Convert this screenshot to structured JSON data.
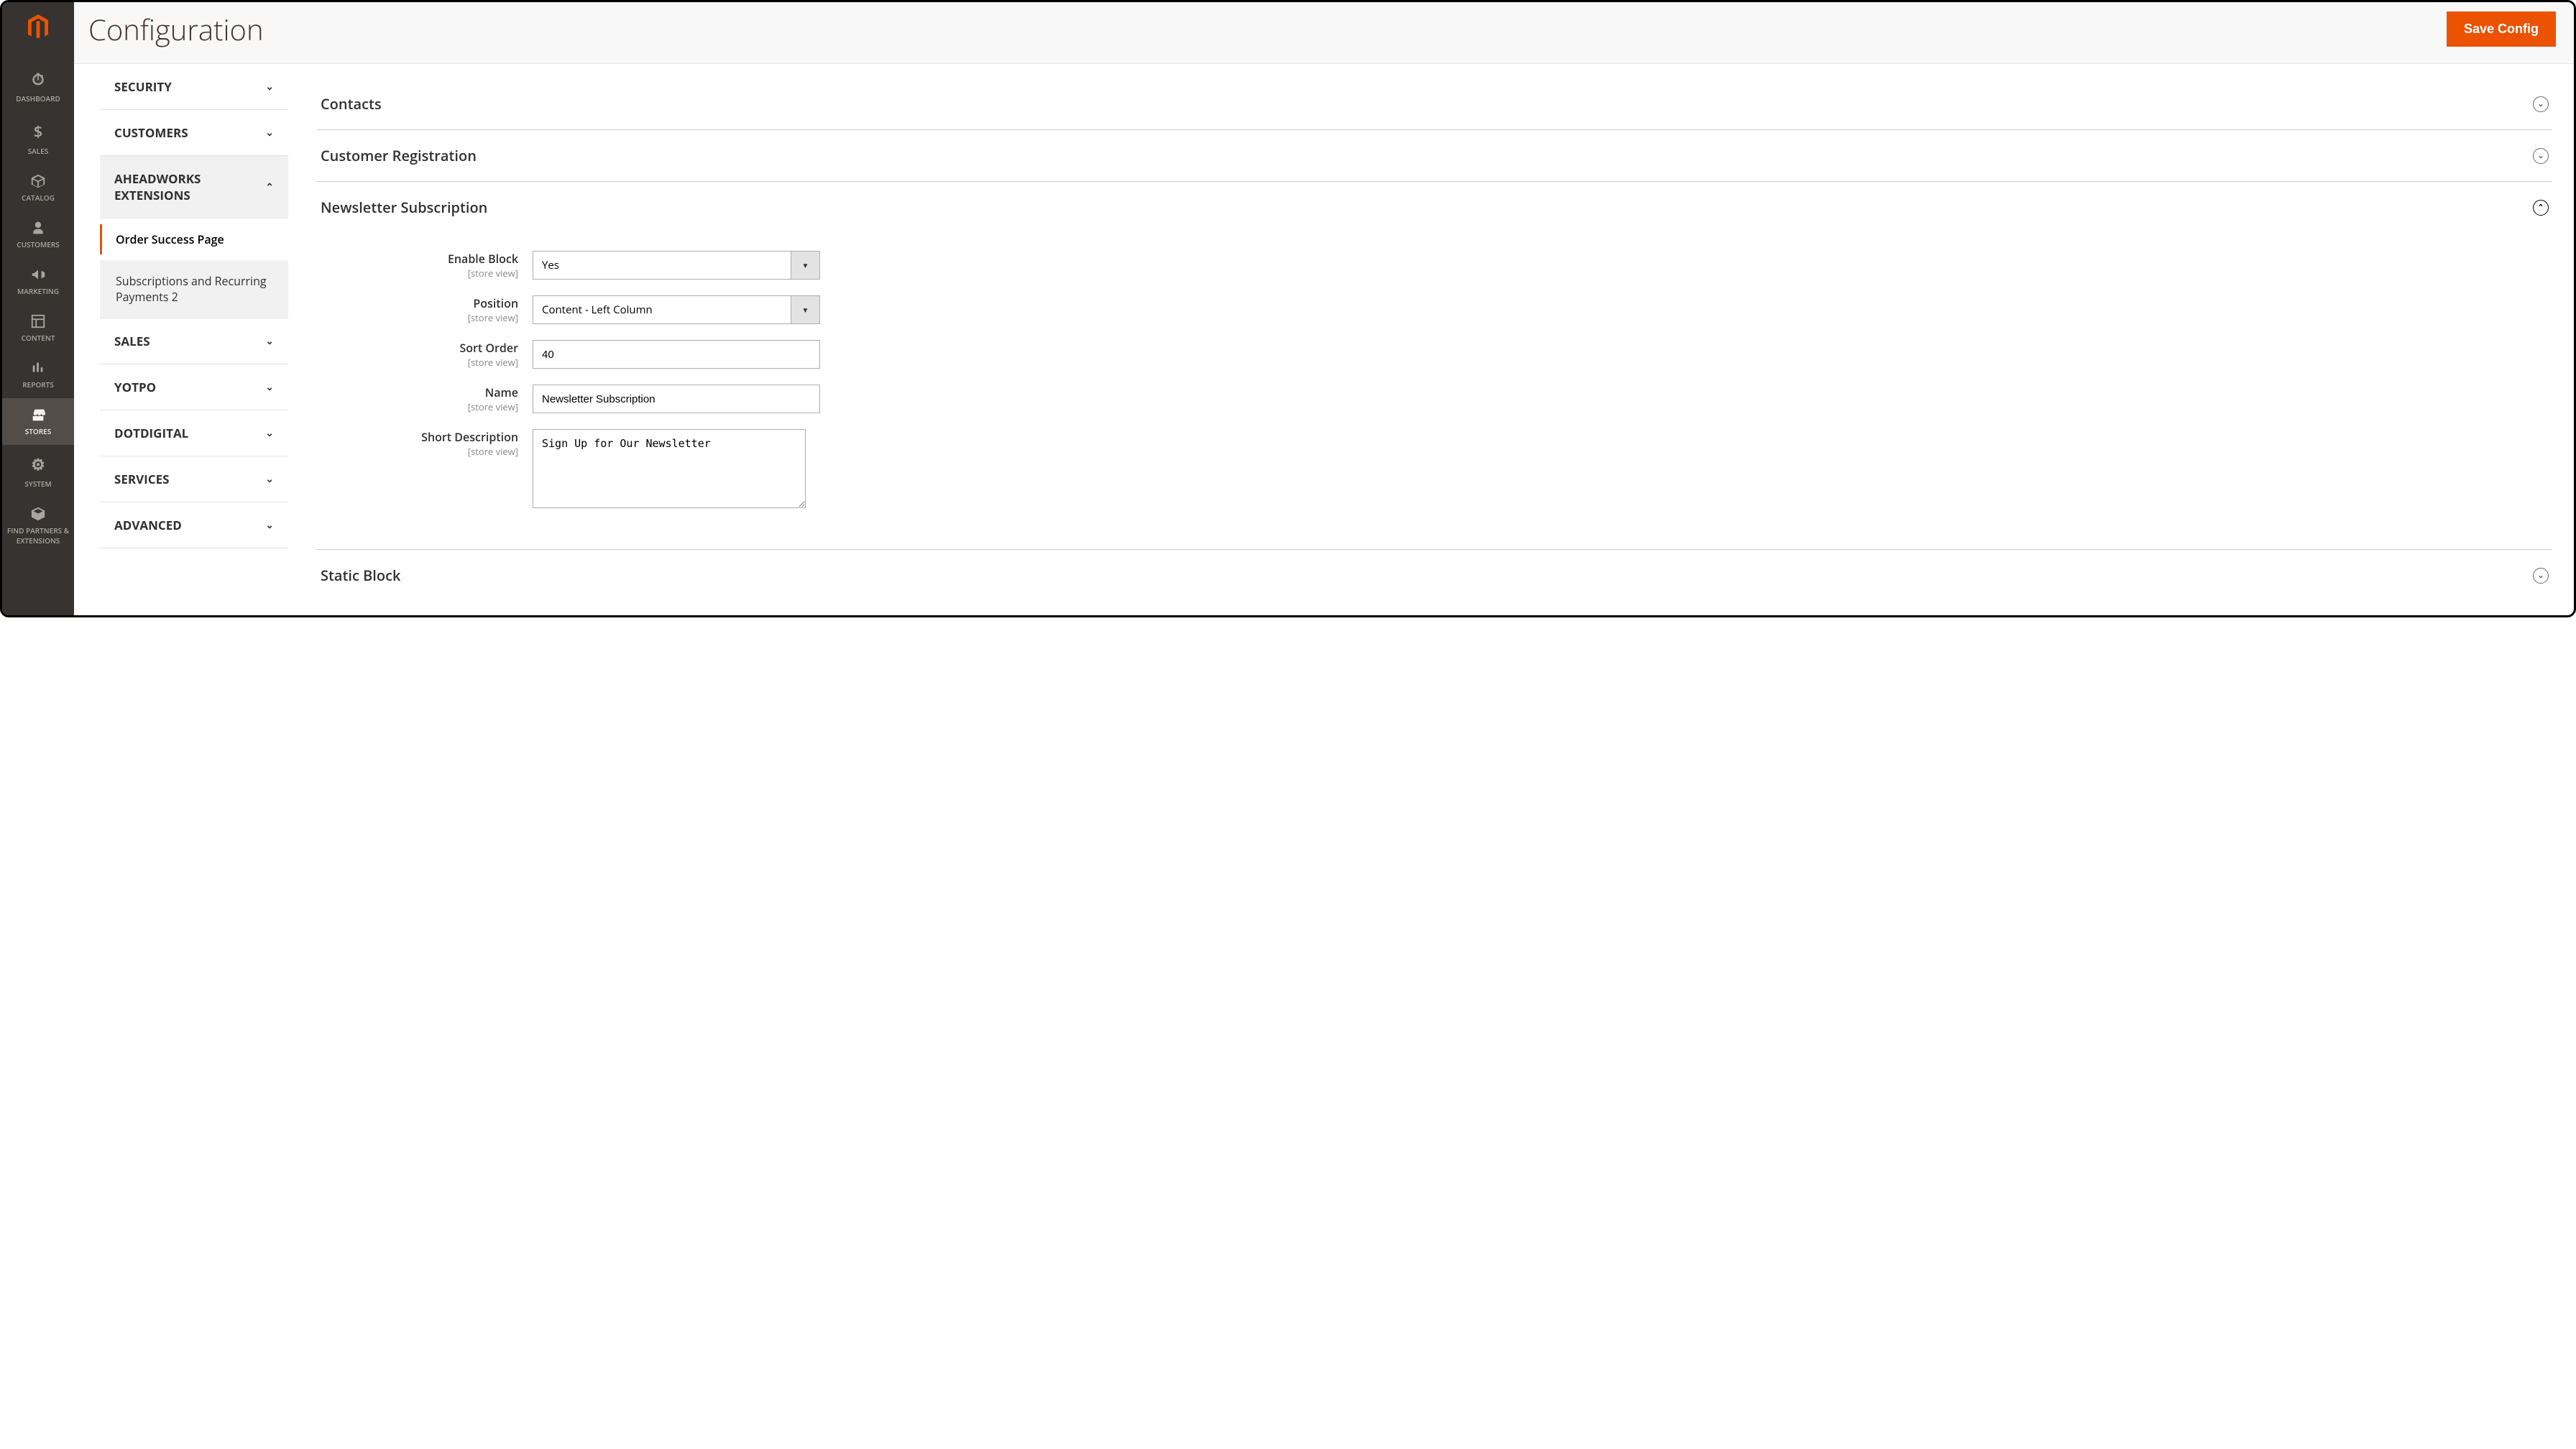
{
  "page": {
    "title": "Configuration",
    "save_button": "Save Config"
  },
  "nav": {
    "dashboard": "DASHBOARD",
    "sales": "SALES",
    "catalog": "CATALOG",
    "customers": "CUSTOMERS",
    "marketing": "MARKETING",
    "content": "CONTENT",
    "reports": "REPORTS",
    "stores": "STORES",
    "system": "SYSTEM",
    "partners": "FIND PARTNERS & EXTENSIONS"
  },
  "sidebar": [
    {
      "label": "SECURITY",
      "expanded": false
    },
    {
      "label": "CUSTOMERS",
      "expanded": false
    },
    {
      "label": "AHEADWORKS EXTENSIONS",
      "expanded": true,
      "items": [
        {
          "label": "Order Success Page",
          "active": true
        },
        {
          "label": "Subscriptions and Recurring Payments 2",
          "active": false
        }
      ]
    },
    {
      "label": "SALES",
      "expanded": false
    },
    {
      "label": "YOTPO",
      "expanded": false
    },
    {
      "label": "DOTDIGITAL",
      "expanded": false
    },
    {
      "label": "SERVICES",
      "expanded": false
    },
    {
      "label": "ADVANCED",
      "expanded": false
    }
  ],
  "groups": {
    "contacts": {
      "title": "Contacts"
    },
    "customer_registration": {
      "title": "Customer Registration"
    },
    "newsletter": {
      "title": "Newsletter Subscription",
      "fields": {
        "enable_block": {
          "label": "Enable Block",
          "scope": "[store view]",
          "value": "Yes"
        },
        "position": {
          "label": "Position",
          "scope": "[store view]",
          "value": "Content - Left Column"
        },
        "sort_order": {
          "label": "Sort Order",
          "scope": "[store view]",
          "value": "40"
        },
        "name": {
          "label": "Name",
          "scope": "[store view]",
          "value": "Newsletter Subscription"
        },
        "short_description": {
          "label": "Short Description",
          "scope": "[store view]",
          "value": "Sign Up for Our Newsletter"
        }
      }
    },
    "static_block": {
      "title": "Static Block"
    }
  }
}
